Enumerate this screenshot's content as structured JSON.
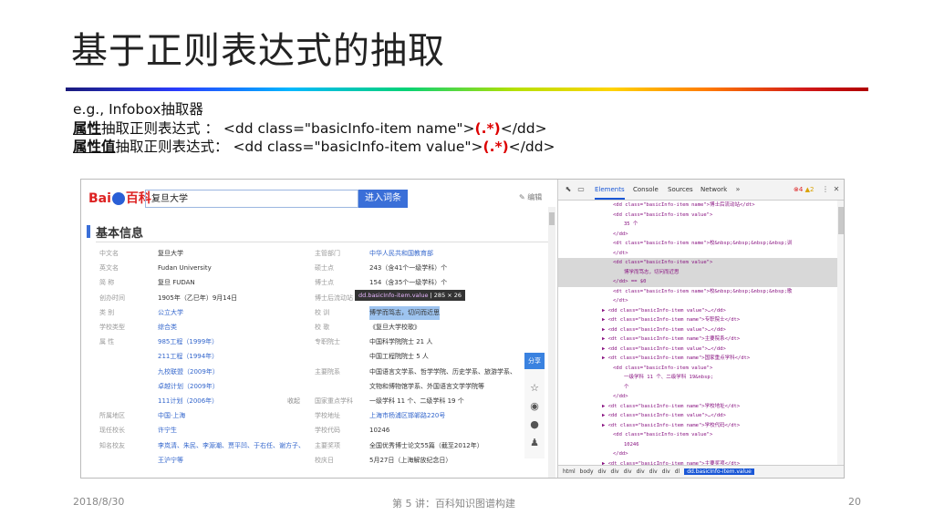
{
  "slide": {
    "title": "基于正则表达式的抽取",
    "line1": "e.g., Infobox抽取器",
    "line2_label": "属性",
    "line2_mid": "抽取正则表达式 ：  <dd class=\"basicInfo-item name\">",
    "line2_capture": "(.*)",
    "line2_end": "</dd>",
    "line3_label": "属性值",
    "line3_mid": "抽取正则表达式：  <dd class=\"basicInfo-item value\">",
    "line3_capture": "(.*)",
    "line3_end": "</dd>",
    "footer_date": "2018/8/30",
    "footer_center": "第 5 讲：百科知识图谱构建",
    "footer_page": "20"
  },
  "colors": {
    "accent": "#d00000",
    "baidu_blue": "#3a6fd8",
    "devtools_tag": "#881280"
  },
  "baike": {
    "logo": "百科",
    "search_value": "复旦大学",
    "search_button": "进入词条",
    "edit_label": "编辑",
    "section_title": "基本信息",
    "share_label": "分享",
    "share_icons": [
      "star-icon",
      "weibo-icon",
      "wechat-icon",
      "qq-icon"
    ],
    "tooltip_tag": "dd.basicInfo-item.value",
    "tooltip_size": "285 × 26",
    "rows": [
      {
        "k1": "中文名",
        "v1": "复旦大学",
        "k2": "主管部门",
        "v2": "中华人民共和国教育部"
      },
      {
        "k1": "英文名",
        "v1": "Fudan University",
        "k2": "硕士点",
        "v2": "243（含41个一级学科）个"
      },
      {
        "k1": "简  称",
        "v1": "复旦 FUDAN",
        "k2": "博士点",
        "v2": "154（含35个一级学科）个"
      },
      {
        "k1": "创办时间",
        "v1": "1905年（乙巳年）9月14日",
        "k2": "博士后流动站",
        "v2": ""
      },
      {
        "k1": "类  别",
        "v1": "公立大学",
        "k2": "校  训",
        "v2": "博学而笃志，切问而近思"
      },
      {
        "k1": "学校类型",
        "v1": "综合类",
        "k2": "校  歌",
        "v2": "《复旦大学校歌》"
      },
      {
        "k1": "属  性",
        "v1": "985工程（1999年）",
        "k2": "专职院士",
        "v2": "中国科学院院士 21 人"
      },
      {
        "k1": "",
        "v1": "211工程（1994年）",
        "k2": "",
        "v2": "中国工程院院士 5 人"
      },
      {
        "k1": "",
        "v1": "九校联盟（2009年）",
        "k2": "主要院系",
        "v2": "中国语言文学系、哲学学院、历史学系、旅游学系、"
      },
      {
        "k1": "",
        "v1": "卓越计划（2009年）",
        "k2": "",
        "v2": "文物和博物馆学系、外国语言文学学院等"
      },
      {
        "k1": "",
        "v1": "111计划（2006年）",
        "k2": "国家重点学科",
        "v2": "一级学科 11 个、二级学科 19 个"
      },
      {
        "k1": "所属地区",
        "v1": "中国·上海",
        "k2": "学校地址",
        "v2": "上海市杨浦区邯郸路220号"
      },
      {
        "k1": "现任校长",
        "v1": "许宁生",
        "k2": "学校代码",
        "v2": "10246"
      },
      {
        "k1": "知名校友",
        "v1": "李岚清、朱民、李源潮、贾平凹、于右任、谢方子、",
        "k2": "主要奖项",
        "v2": "全国优秀博士论文55篇（截至2012年）"
      },
      {
        "k1": "",
        "v1": "王沪宁等",
        "k2": "校庆日",
        "v2": "5月27日（上海解放纪念日）"
      }
    ],
    "collapse_label": "收起"
  },
  "devtools": {
    "tabs": [
      "Elements",
      "Console",
      "Sources",
      "Network"
    ],
    "warnings": "4",
    "errors": "2",
    "lines": [
      {
        "ind": 10,
        "t": "<dd class=\"basicInfo-item name\">博士后流动站</dt>"
      },
      {
        "ind": 10,
        "t": "<dd class=\"basicInfo-item value\">"
      },
      {
        "ind": 12,
        "t": "35 个"
      },
      {
        "ind": 10,
        "t": "</dd>"
      },
      {
        "ind": 10,
        "t": "<dt class=\"basicInfo-item name\">校&nbsp;&nbsp;&nbsp;&nbsp;训"
      },
      {
        "ind": 10,
        "t": "</dt>"
      },
      {
        "ind": 10,
        "t": "<dd class=\"basicInfo-item value\">"
      },
      {
        "ind": 12,
        "t": "博学而笃志，切问而近思"
      },
      {
        "ind": 10,
        "t": "</dd> == $0"
      },
      {
        "ind": 10,
        "t": "<dt class=\"basicInfo-item name\">校&nbsp;&nbsp;&nbsp;&nbsp;歌"
      },
      {
        "ind": 10,
        "t": "</dt>"
      },
      {
        "ind": 8,
        "t": "▶ <dd class=\"basicInfo-item value\">…</dd>"
      },
      {
        "ind": 8,
        "t": "▶ <dt class=\"basicInfo-item name\">专职院士</dt>"
      },
      {
        "ind": 8,
        "t": "▶ <dd class=\"basicInfo-item value\">…</dd>"
      },
      {
        "ind": 8,
        "t": "▶ <dt class=\"basicInfo-item name\">主要院系</dt>"
      },
      {
        "ind": 8,
        "t": "▶ <dd class=\"basicInfo-item value\">…</dd>"
      },
      {
        "ind": 8,
        "t": "▶ <dt class=\"basicInfo-item name\">国家重点学科</dt>"
      },
      {
        "ind": 10,
        "t": "<dd class=\"basicInfo-item value\">"
      },
      {
        "ind": 12,
        "t": "一级学科 11 个、二级学科 19&nbsp;"
      },
      {
        "ind": 12,
        "t": "个"
      },
      {
        "ind": 10,
        "t": "</dd>"
      },
      {
        "ind": 8,
        "t": "▶ <dt class=\"basicInfo-item name\">学校地址</dt>"
      },
      {
        "ind": 8,
        "t": "▶ <dd class=\"basicInfo-item value\">…</dd>"
      },
      {
        "ind": 8,
        "t": "▶ <dt class=\"basicInfo-item name\">学校代码</dt>"
      },
      {
        "ind": 10,
        "t": "<dd class=\"basicInfo-item value\">"
      },
      {
        "ind": 12,
        "t": "10246"
      },
      {
        "ind": 10,
        "t": "</dd>"
      },
      {
        "ind": 8,
        "t": "▶ <dt class=\"basicInfo-item name\">主要奖项</dt>"
      },
      {
        "ind": 10,
        "t": "<dd class=\"basicInfo-item value\">"
      },
      {
        "ind": 12,
        "t": "全国优秀博士论文55篇（截至2012年）"
      },
      {
        "ind": 10,
        "t": "</dd>"
      },
      {
        "ind": 8,
        "t": "▶ <dt class=\"basicInfo-item name\">校庆日</dt>"
      },
      {
        "ind": 8,
        "t": "▶ <dd class=\"basicInfo-item value\">…</dd>"
      }
    ],
    "crumbs": [
      "html",
      "body",
      "div",
      "div",
      "div",
      "div",
      "div",
      "div",
      "dl"
    ],
    "crumb_last": "dd.basicInfo-item.value"
  }
}
